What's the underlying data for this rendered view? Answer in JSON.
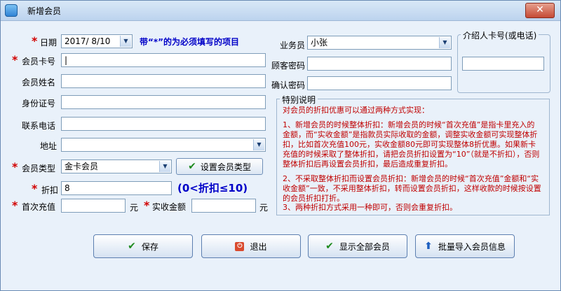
{
  "window": {
    "title": "新增会员",
    "close_label": "✕"
  },
  "form": {
    "date_label": "日期",
    "date_value": "2017/ 8/10",
    "required_hint": "带“*”的为必须填写的项目",
    "card_label": "会员卡号",
    "card_value": "|",
    "name_label": "会员姓名",
    "idcard_label": "身份证号",
    "phone_label": "联系电话",
    "address_label": "地址",
    "type_label": "会员类型",
    "type_value": "金卡会员",
    "set_type_button": "设置会员类型",
    "discount_label": "折扣",
    "discount_value": "8",
    "discount_hint": "(0<折扣≤10)",
    "first_recharge_label": "首次充值",
    "yuan1": "元",
    "actual_amount_label": "实收金额",
    "yuan2": "元",
    "salesman_label": "业务员",
    "salesman_value": "小张",
    "customer_pwd_label": "顾客密码",
    "confirm_pwd_label": "确认密码",
    "referrer_title": "介绍人卡号(或电话)"
  },
  "notes": {
    "title": "特别说明",
    "lines": [
      "对会员的折扣优惠可以通过两种方式实现：",
      "1、新增会员的时候整体折扣：新增会员的时候“首次充值”是指卡里充入的金额，而“实收金额”是指款员实际收取的金额，调整实收金额可实现整体折扣，比如首次充值100元，实收金额80元即可实现整体8折优惠。如果新卡充值的时候采取了整体折扣，请把会员折扣设置为“10”（就是不折扣），否则整体折扣后再设置会员折扣，最后造成重复折扣。",
      "2、不采取整体折扣而设置会员折扣：新增会员的时候“首次充值”金额和“实收金额”一致，不采用整体折扣，转而设置会员折扣，这样收款的时候按设置的会员折扣打折。",
      "3、两种折扣方式采用一种即可，否则会重复折扣。"
    ]
  },
  "buttons": {
    "save": "保存",
    "exit": "退出",
    "show_all": "显示全部会员",
    "batch_import": "批量导入会员信息"
  }
}
